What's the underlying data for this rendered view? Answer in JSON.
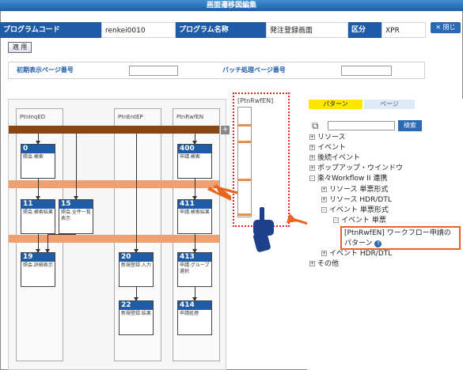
{
  "window": {
    "title": "画面遷移図編集",
    "close_label": "✕ 閉じ"
  },
  "header": {
    "program_code_label": "プログラムコード",
    "program_code_value": "renkei0010",
    "program_name_label": "プログラム名称",
    "program_name_value": "発注登録画面",
    "category_label": "区分",
    "category_value": "XPR"
  },
  "apply_label": "適 用",
  "page_settings": {
    "initial_page_label": "初期表示ページ番号",
    "batch_page_label": "バッチ処理ページ番号"
  },
  "lanes": [
    {
      "title": "PtnInqED"
    },
    {
      "title": "PtnEntEP"
    },
    {
      "title": "PtnRwfEN"
    }
  ],
  "nodes": [
    {
      "id": "0",
      "text": "照会.検索"
    },
    {
      "id": "11",
      "text": "照会.検索結果"
    },
    {
      "id": "15",
      "text": "照会.全件一覧表示"
    },
    {
      "id": "19",
      "text": "照会.詳細表示"
    },
    {
      "id": "20",
      "text": "新規登録.入力"
    },
    {
      "id": "22",
      "text": "新規登録.結果"
    },
    {
      "id": "400",
      "text": "申請.検索"
    },
    {
      "id": "411",
      "text": "申請.検索結果"
    },
    {
      "id": "413",
      "text": "申請.グループ選択"
    },
    {
      "id": "414",
      "text": "申請処理"
    }
  ],
  "scrollbar_label": "[PtnRwfEN]",
  "tabs": {
    "pattern": "パターン",
    "page": "ページ"
  },
  "search_button": "検索",
  "tree": [
    {
      "label": "リソース",
      "level": 0,
      "sign": "+"
    },
    {
      "label": "イベント",
      "level": 0,
      "sign": "+"
    },
    {
      "label": "後続イベント",
      "level": 0,
      "sign": "+"
    },
    {
      "label": "ポップアップ・ウインドウ",
      "level": 0,
      "sign": "+"
    },
    {
      "label": "楽々Workflow II 連携",
      "level": 0,
      "sign": "-"
    },
    {
      "label": "リソース 単票形式",
      "level": 1,
      "sign": "+"
    },
    {
      "label": "リソース HDR/DTL",
      "level": 1,
      "sign": "+"
    },
    {
      "label": "イベント 単票形式",
      "level": 1,
      "sign": "-"
    },
    {
      "label": "イベント 単票",
      "level": 2,
      "sign": "-"
    },
    {
      "label": "イベント HDR/DTL",
      "level": 1,
      "sign": "+"
    },
    {
      "label": "その他",
      "level": 0,
      "sign": "+"
    }
  ],
  "callout": {
    "line1": "[PtnRwfEN] ワークフロー申請の",
    "line2": "パターン"
  },
  "colors": {
    "accent": "#1e5ca8",
    "bar_dark": "#8b4513",
    "bar_light": "#f0a070",
    "highlight": "#e8651f"
  }
}
